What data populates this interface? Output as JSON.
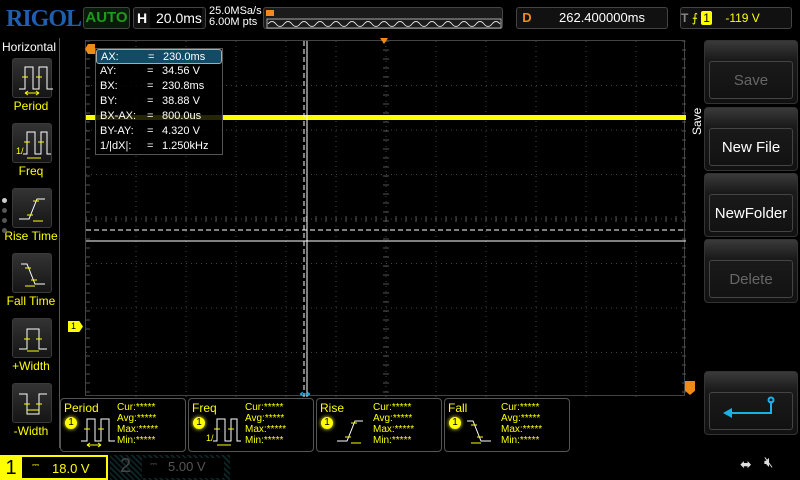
{
  "header": {
    "logo": "RIGOL",
    "run_state": "AUTO",
    "h_label": "H",
    "timebase": "20.0ms",
    "sample_rate": "25.0MSa/s",
    "memory_depth": "6.00M pts",
    "delay_label": "D",
    "delay": "262.400000ms",
    "trigger_label": "T",
    "trigger_source": "1",
    "trigger_level": "-119 V"
  },
  "sidebar": {
    "title": "Horizontal",
    "items": [
      {
        "label": "Period"
      },
      {
        "label": "Freq"
      },
      {
        "label": "Rise Time"
      },
      {
        "label": "Fall Time"
      },
      {
        "label": "+Width"
      },
      {
        "label": "-Width"
      }
    ]
  },
  "cursor_panel": {
    "rows": [
      {
        "k": "AX:",
        "v": "230.0ms"
      },
      {
        "k": "AY:",
        "v": "34.56 V"
      },
      {
        "k": "BX:",
        "v": "230.8ms"
      },
      {
        "k": "BY:",
        "v": "38.88 V"
      },
      {
        "k": "BX-AX:",
        "v": "800.0us"
      },
      {
        "k": "BY-AY:",
        "v": "4.320 V"
      },
      {
        "k": "1/|dX|:",
        "v": "1.250kHz"
      }
    ],
    "eq": "="
  },
  "right_menu": {
    "title": "Save",
    "buttons": [
      {
        "label": "Save",
        "enabled": false
      },
      {
        "label": "New File",
        "enabled": true
      },
      {
        "label": "NewFolder",
        "enabled": true
      },
      {
        "label": "Delete",
        "enabled": false
      }
    ]
  },
  "measurements": [
    {
      "name": "Period",
      "source": "1",
      "cur": "Cur:*****",
      "avg": "Avg:*****",
      "max": "Max:*****",
      "min": "Min:*****"
    },
    {
      "name": "Freq",
      "source": "1",
      "cur": "Cur:*****",
      "avg": "Avg:*****",
      "max": "Max:*****",
      "min": "Min:*****"
    },
    {
      "name": "Rise",
      "source": "1",
      "cur": "Cur:*****",
      "avg": "Avg:*****",
      "max": "Max:*****",
      "min": "Min:*****"
    },
    {
      "name": "Fall",
      "source": "1",
      "cur": "Cur:*****",
      "avg": "Avg:*****",
      "max": "Max:*****",
      "min": "Min:*****"
    }
  ],
  "channels": [
    {
      "num": "1",
      "scale": "18.0 V",
      "active": true
    },
    {
      "num": "2",
      "scale": "5.00 V",
      "active": false
    }
  ],
  "ch1_marker": "1",
  "colors": {
    "ch1": "#ffff00",
    "accent": "#f08a1a",
    "cursor": "#ffffff",
    "back": "#1ab0e8"
  }
}
